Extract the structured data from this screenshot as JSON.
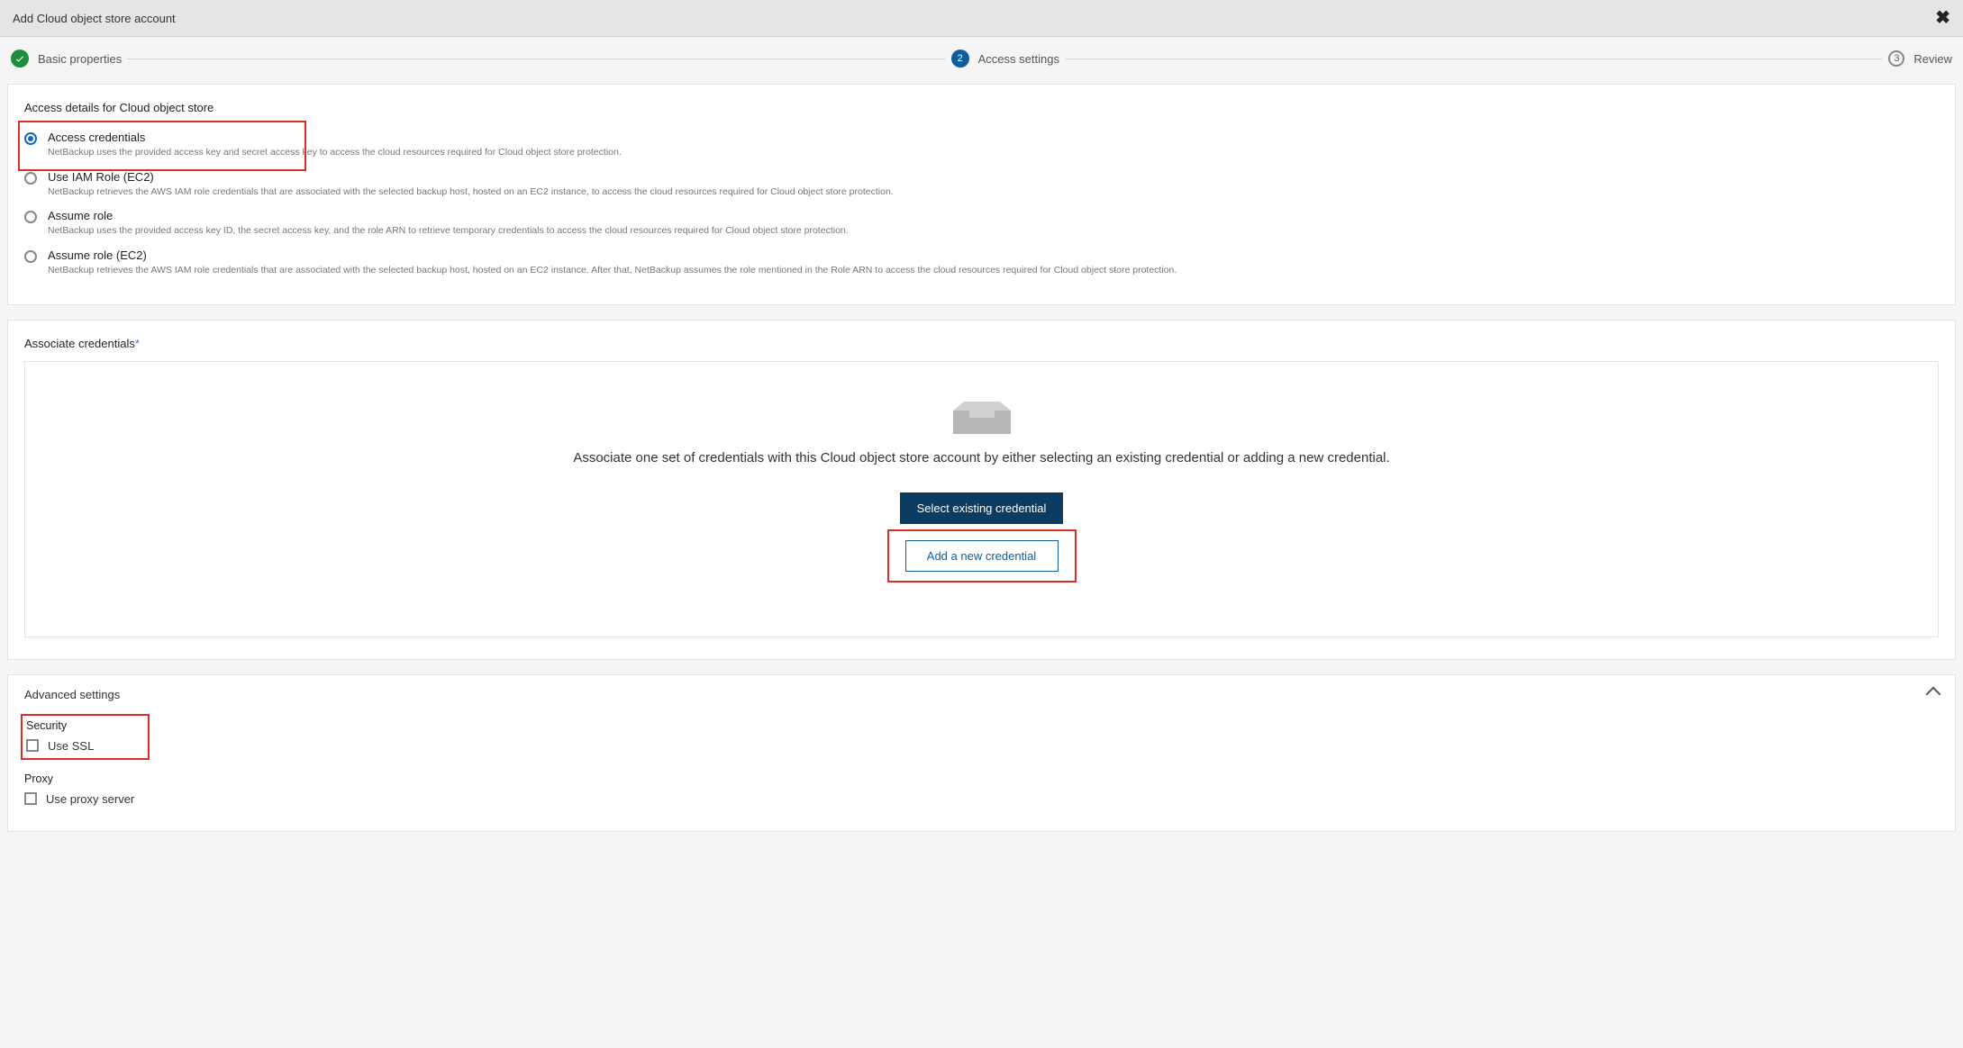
{
  "header": {
    "title": "Add Cloud object store account"
  },
  "steps": {
    "s1": {
      "label": "Basic properties"
    },
    "s2": {
      "num": "2",
      "label": "Access settings"
    },
    "s3": {
      "num": "3",
      "label": "Review"
    }
  },
  "access": {
    "heading": "Access details for Cloud object store",
    "options": [
      {
        "title": "Access credentials",
        "desc": "NetBackup uses the provided access key and secret access key to access the cloud resources required for Cloud object store protection."
      },
      {
        "title": "Use IAM Role (EC2)",
        "desc": "NetBackup retrieves the AWS IAM role credentials that are associated with the selected backup host, hosted on an EC2 instance, to access the cloud resources required for Cloud object store protection."
      },
      {
        "title": "Assume role",
        "desc": "NetBackup uses the provided access key ID, the secret access key, and the role ARN to retrieve temporary credentials to access the cloud resources required for Cloud object store protection."
      },
      {
        "title": "Assume role (EC2)",
        "desc": "NetBackup retrieves the AWS IAM role credentials that are associated with the selected backup host, hosted on an EC2 instance. After that, NetBackup assumes the role mentioned in the Role ARN to access the cloud resources required for Cloud object store protection."
      }
    ]
  },
  "associate": {
    "heading": "Associate credentials",
    "star": "*",
    "text": "Associate one set of credentials with this Cloud object store account by either selecting an existing credential or adding a new credential.",
    "btn_existing": "Select existing credential",
    "btn_new": "Add a new credential"
  },
  "advanced": {
    "heading": "Advanced settings",
    "security_label": "Security",
    "use_ssl": "Use SSL",
    "proxy_label": "Proxy",
    "use_proxy": "Use proxy server"
  }
}
